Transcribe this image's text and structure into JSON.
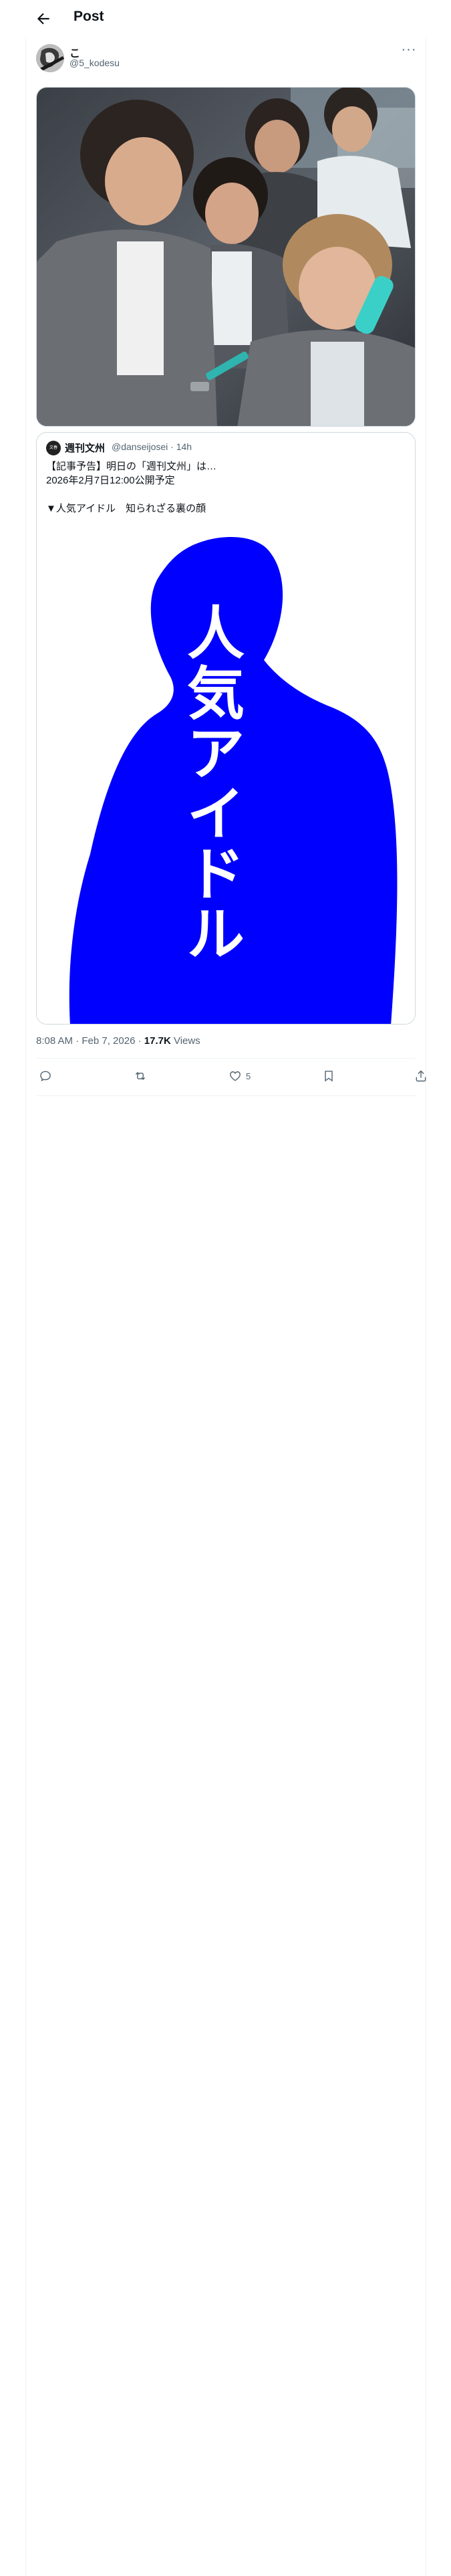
{
  "header": {
    "title": "Post"
  },
  "author": {
    "display_name": "こ",
    "handle": "@5_kodesu"
  },
  "quoted": {
    "name": "週刊文州",
    "handle": "@danseijosei",
    "time": "14h",
    "text_lines": [
      "【記事予告】明日の「週刊文州」は…",
      "2026年2月7日12:00公開予定",
      "",
      "▼人気アイドル　知られざる裏の顔"
    ],
    "image_text": "人気アイドル",
    "colors": {
      "silhouette": "#0000ff"
    }
  },
  "meta": {
    "time": "8:08 AM · Feb 7, 2026 · ",
    "views": "17.7K",
    "views_label": " Views"
  },
  "actions": {
    "reply_count": "",
    "repost_count": "",
    "like_count": "5"
  }
}
